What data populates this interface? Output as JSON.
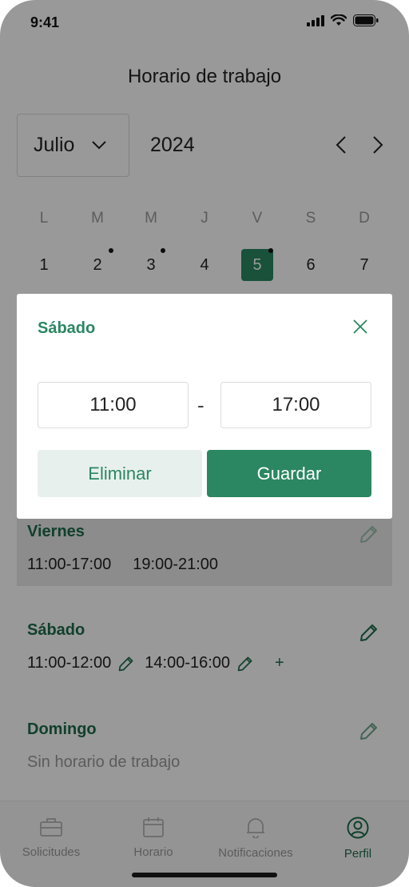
{
  "status_bar": {
    "time": "9:41"
  },
  "header": {
    "title": "Horario de trabajo"
  },
  "calendar": {
    "month": "Julio",
    "year": "2024",
    "weekdays": [
      "L",
      "M",
      "M",
      "J",
      "V",
      "S",
      "D"
    ],
    "days": [
      "1",
      "2",
      "3",
      "4",
      "5",
      "6",
      "7"
    ],
    "selected_day": "5"
  },
  "schedule": {
    "viernes": {
      "name": "Viernes",
      "slot1": "11:00-17:00",
      "slot2": "19:00-21:00"
    },
    "sabado": {
      "name": "Sábado",
      "slot1": "11:00-12:00",
      "slot2": "14:00-16:00",
      "add": "+"
    },
    "domingo": {
      "name": "Domingo",
      "empty": "Sin horario de trabajo"
    }
  },
  "bottom_nav": {
    "items": [
      {
        "label": "Solicitudes",
        "icon": "briefcase-icon"
      },
      {
        "label": "Horario",
        "icon": "calendar-icon"
      },
      {
        "label": "Notificaciones",
        "icon": "bell-icon"
      },
      {
        "label": "Perfil",
        "icon": "user-icon"
      }
    ],
    "active": "Perfil"
  },
  "modal": {
    "title": "Sábado",
    "start_time": "11:00",
    "separator": "-",
    "end_time": "17:00",
    "delete_label": "Eliminar",
    "save_label": "Guardar"
  },
  "colors": {
    "accent": "#2a8762",
    "accent_dark": "#1d6b4c",
    "accent_light": "#e8f0ed"
  }
}
